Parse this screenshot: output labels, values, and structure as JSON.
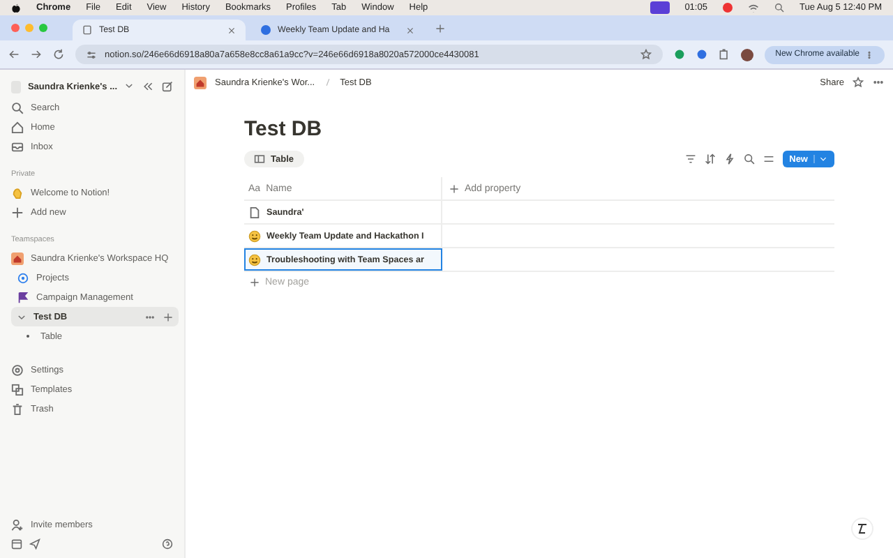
{
  "menubar": {
    "app": "Chrome",
    "menus": [
      "File",
      "Edit",
      "View",
      "History",
      "Bookmarks",
      "Profiles",
      "Tab",
      "Window",
      "Help"
    ],
    "timer": "01:05",
    "clock": "Tue Aug 5  12:40 PM"
  },
  "browser_tabs": [
    {
      "title": "Test DB",
      "selected": true
    },
    {
      "title": "Weekly Team Update and Ha",
      "selected": false
    }
  ],
  "address_bar": {
    "url": "notion.so/246e66d6918a80a7a658e8cc8a61a9cc?v=246e66d6918a8020a572000ce4430081"
  },
  "update_button": "New Chrome available",
  "sidebar": {
    "workspace": "Saundra Krienke's ...",
    "nav": [
      {
        "label": "Search",
        "kind": "search"
      },
      {
        "label": "Home",
        "kind": "home"
      },
      {
        "label": "Inbox",
        "kind": "inbox"
      }
    ],
    "private_heading": "Private",
    "private_items": [
      {
        "label": "Welcome to Notion!",
        "kind": "wave"
      },
      {
        "label": "Add new",
        "kind": "add"
      }
    ],
    "teamspaces_heading": "Teamspaces",
    "tree": [
      {
        "label": "Saundra Krienke's Workspace HQ",
        "kind": "house",
        "selected": false,
        "children": [
          {
            "label": "Projects",
            "kind": "target",
            "selected": false
          },
          {
            "label": "Campaign Management",
            "kind": "flag",
            "selected": false
          },
          {
            "label": "Test DB",
            "kind": "database",
            "selected": true,
            "expanded": true,
            "children": [
              {
                "label": "Table",
                "kind": "view",
                "selected": false
              }
            ]
          }
        ]
      }
    ],
    "footer_items": [
      {
        "label": "Settings",
        "kind": "settings"
      },
      {
        "label": "Templates",
        "kind": "templates"
      },
      {
        "label": "Trash",
        "kind": "trash"
      }
    ],
    "invite": "Invite members"
  },
  "breadcrumbs": [
    "Saundra Krienke's Wor...",
    "Test DB"
  ],
  "share": "Share",
  "page_title": "Test DB",
  "view_tab": "Table",
  "new_button": "New",
  "table": {
    "columns": [
      "Aa",
      "Name",
      "Add property"
    ],
    "rows": [
      {
        "kind": "page",
        "title": "Saundra'",
        "selected": false
      },
      {
        "kind": "emoji",
        "title": "Weekly Team Update and Hackathon I",
        "selected": false
      },
      {
        "kind": "emoji",
        "title": "Troubleshooting with Team Spaces ar",
        "selected": true
      }
    ],
    "new_row": "New page"
  }
}
